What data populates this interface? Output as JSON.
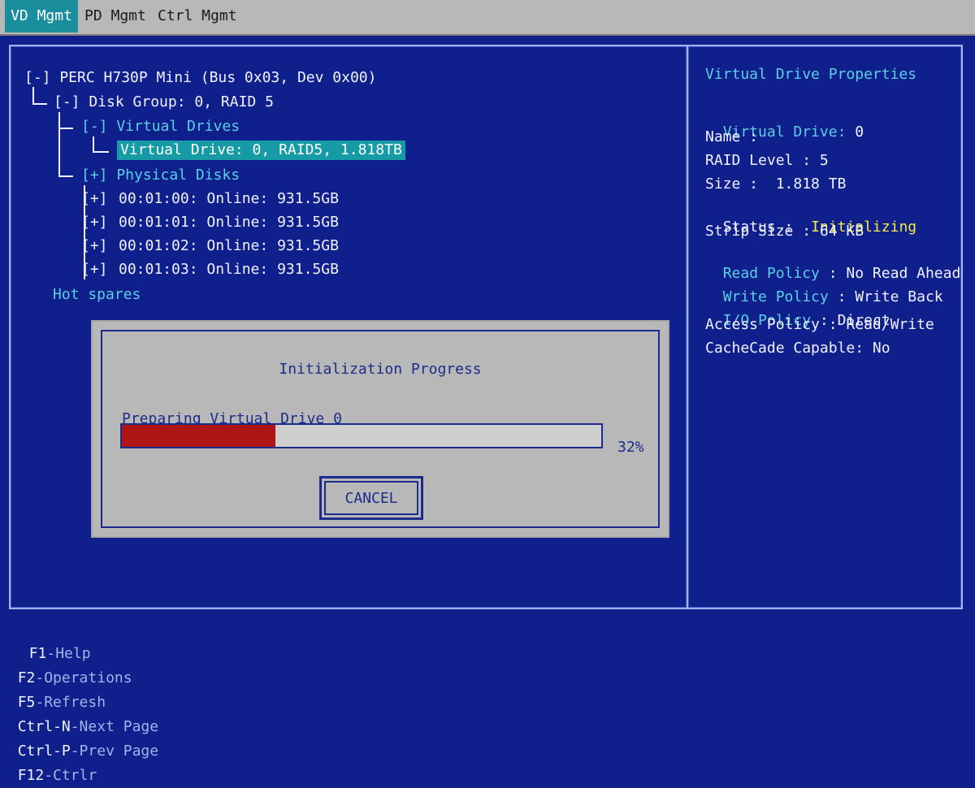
{
  "tabs": [
    {
      "label": "VD Mgmt",
      "active": true
    },
    {
      "label": "PD Mgmt",
      "active": false
    },
    {
      "label": "Ctrl Mgmt",
      "active": false
    }
  ],
  "tree": {
    "controller": "[-] PERC H730P Mini (Bus 0x03, Dev 0x00)",
    "disk_group": "[-] Disk Group: 0, RAID 5",
    "virtual_drives": "[-] Virtual Drives",
    "virtual_drive_item": "Virtual Drive: 0, RAID5, 1.818TB",
    "physical_disks": "[+] Physical Disks",
    "disks": [
      {
        "expander": "[+]",
        "label": "00:01:00: Online: 931.5GB"
      },
      {
        "expander": "[+]",
        "label": "00:01:01: Online: 931.5GB"
      },
      {
        "expander": "[+]",
        "label": "00:01:02: Online: 931.5GB"
      },
      {
        "expander": "[+]",
        "label": "00:01:03: Online: 931.5GB"
      }
    ],
    "hot_spares": "Hot spares"
  },
  "properties": {
    "title": "Virtual Drive Properties",
    "virtual_drive_label": "Virtual Drive: ",
    "virtual_drive_value": "0",
    "name": "Name :",
    "raid_level": "RAID Level : 5",
    "size": "Size :  1.818 TB",
    "status_label": "Status :",
    "status_value": "Initializing",
    "strip_size": "Strip Size : 64 KB",
    "read_policy_label": "Read Policy",
    "read_policy_value": " : No Read Ahead",
    "write_policy_label": "Write Policy",
    "write_policy_value": " : Write Back",
    "io_policy_label": "I/O Policy",
    "io_policy_value": " : Direct",
    "access_policy": "Access Policy : Read/Write",
    "cachecade": "CacheCade Capable: No"
  },
  "dialog": {
    "title": "Initialization Progress",
    "label": "Preparing Virtual Drive 0",
    "progress": 0.32,
    "percent_text": "32%",
    "cancel_label": "CANCEL"
  },
  "footer": [
    {
      "key": "F1",
      "label": "-Help"
    },
    {
      "key": "F2",
      "label": "-Operations"
    },
    {
      "key": "F5",
      "label": "-Refresh"
    },
    {
      "key": "Ctrl-N",
      "label": "-Next Page"
    },
    {
      "key": "Ctrl-P",
      "label": "-Prev Page"
    },
    {
      "key": "F12",
      "label": "-Ctrlr"
    }
  ],
  "colors": {
    "background": "#0f1f8c",
    "selected": "#169aa6",
    "status_initializing": "#f4ea4a",
    "progress_fill": "#b01515",
    "tab_active": "#1a8e9c"
  }
}
